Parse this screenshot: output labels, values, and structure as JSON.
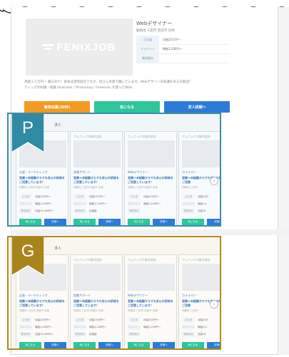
{
  "job": {
    "title": "Webデザイナー",
    "meta": "勤務地 三田市 西宮市 尼崎",
    "logo": "FENIXJOB",
    "rows": [
      {
        "k": "正社員",
        "v": "月給25万円〜"
      },
      {
        "k": "アルバイト",
        "v": "時給1,200円〜"
      },
      {
        "k": "業務委託",
        "v": ""
      }
    ],
    "description_1": "月給２５万円〜 賞与あり！基本は定時退社ですが、皆さん笑顔で働いています。Webデザインの知識のある方歓迎！",
    "description_2": "ティングの知識・経験 Illustrator / Photoshop / Fireworks を使ったWeb..."
  },
  "buttons": {
    "apply": "簡単応募(30秒)",
    "favorite": "気になる",
    "detail": "求人詳細へ"
  },
  "sections": {
    "p_label": "P",
    "g_label": "G",
    "heading": "求人"
  },
  "cards": [
    {
      "tag": "",
      "title": "企画・マーケティング",
      "catch": "営業＋未経験からでも安心の研修をご用意しています！",
      "meta": "勤務地 三田市 西宮市 尼崎",
      "r1k": "正社員",
      "r1v": "月給20万円〜",
      "r2k": "アルバイト",
      "r2v": "時給1,050円〜",
      "r3k": "業務委託",
      "r3v": "日給10,000円〜"
    },
    {
      "tag": "フェニックス株式会社",
      "title": "営業サポート",
      "catch": "営業＋未経験からでも安心の研修をご用意しています！",
      "meta": "勤務地 三田市 西宮市 尼崎",
      "r1k": "正社員",
      "r1v": "月給23万円〜",
      "r2k": "アルバイト",
      "r2v": "時給1,100円〜",
      "r3k": "業務委託",
      "r3v": "応相談"
    },
    {
      "tag": "フェニックス株式会社",
      "title": "Webデザイナー",
      "catch": "営業＋未経験からでも安心の研修をご用意しています！",
      "meta": "勤務地 三田市 西宮市 尼崎",
      "r1k": "正社員",
      "r1v": "月給25万円〜",
      "r2k": "アルバイト",
      "r2v": "時給1,200円〜",
      "r3k": "業務委託",
      "r3v": ""
    },
    {
      "tag": "フェニックス株式会社",
      "title": "カメラマン",
      "catch": "営業＋未経験からでも安心の研修をご用意",
      "meta": "勤務地 三田市",
      "r1k": "正社員",
      "r1v": "月給20万",
      "r2k": "アルバイト",
      "r2v": "時給1,0",
      "r3k": "業務委託",
      "r3v": "日給10"
    }
  ],
  "mini_buttons": {
    "favorite": "気になる",
    "detail": "詳細へ"
  },
  "icons": {
    "next": "chevron-right-icon"
  },
  "colors": {
    "p_ribbon": "#2f8aa3",
    "g_ribbon": "#a8841c",
    "apply": "#f39a20",
    "favorite": "#2ec59c",
    "detail": "#2c7bd8"
  }
}
